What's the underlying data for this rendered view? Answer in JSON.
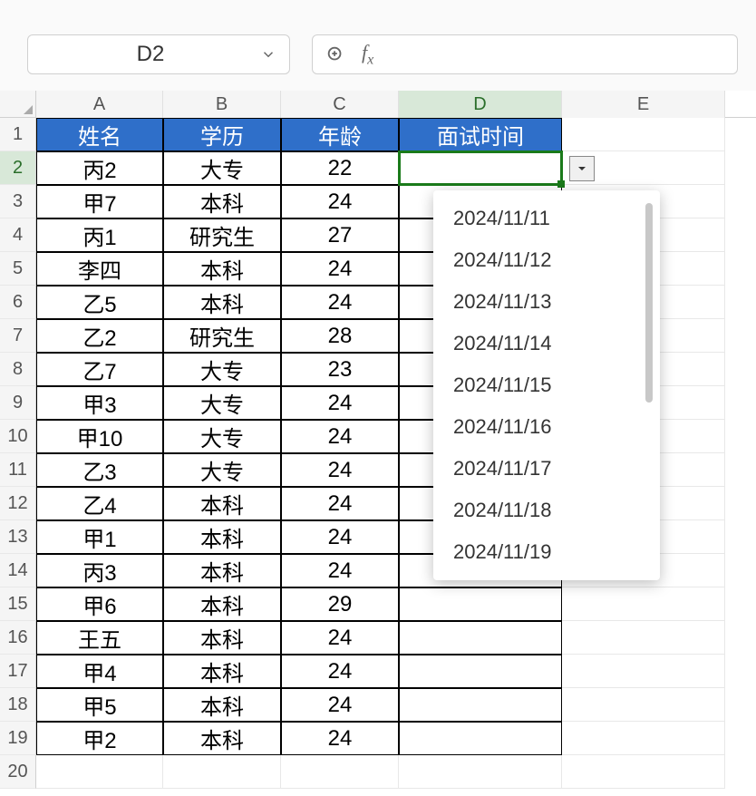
{
  "namebox": {
    "value": "D2"
  },
  "formula": {
    "value": ""
  },
  "columns": [
    "A",
    "B",
    "C",
    "D",
    "E"
  ],
  "col_widths": [
    "cA",
    "cB",
    "cC",
    "cD",
    "cE"
  ],
  "selected_col_index": 3,
  "row_numbers": [
    1,
    2,
    3,
    4,
    5,
    6,
    7,
    8,
    9,
    10,
    11,
    12,
    13,
    14,
    15,
    16,
    17,
    18,
    19,
    20
  ],
  "selected_row_index": 1,
  "headers": {
    "a": "姓名",
    "b": "学历",
    "c": "年龄",
    "d": "面试时间"
  },
  "data": [
    {
      "a": "丙2",
      "b": "大专",
      "c": "22",
      "d": ""
    },
    {
      "a": "甲7",
      "b": "本科",
      "c": "24",
      "d": ""
    },
    {
      "a": "丙1",
      "b": "研究生",
      "c": "27",
      "d": ""
    },
    {
      "a": "李四",
      "b": "本科",
      "c": "24",
      "d": ""
    },
    {
      "a": "乙5",
      "b": "本科",
      "c": "24",
      "d": ""
    },
    {
      "a": "乙2",
      "b": "研究生",
      "c": "28",
      "d": ""
    },
    {
      "a": "乙7",
      "b": "大专",
      "c": "23",
      "d": ""
    },
    {
      "a": "甲3",
      "b": "大专",
      "c": "24",
      "d": ""
    },
    {
      "a": "甲10",
      "b": "大专",
      "c": "24",
      "d": ""
    },
    {
      "a": "乙3",
      "b": "大专",
      "c": "24",
      "d": ""
    },
    {
      "a": "乙4",
      "b": "本科",
      "c": "24",
      "d": ""
    },
    {
      "a": "甲1",
      "b": "本科",
      "c": "24",
      "d": ""
    },
    {
      "a": "丙3",
      "b": "本科",
      "c": "24",
      "d": ""
    },
    {
      "a": "甲6",
      "b": "本科",
      "c": "29",
      "d": ""
    },
    {
      "a": "王五",
      "b": "本科",
      "c": "24",
      "d": ""
    },
    {
      "a": "甲4",
      "b": "本科",
      "c": "24",
      "d": ""
    },
    {
      "a": "甲5",
      "b": "本科",
      "c": "24",
      "d": ""
    },
    {
      "a": "甲2",
      "b": "本科",
      "c": "24",
      "d": ""
    }
  ],
  "dropdown": {
    "options": [
      "2024/11/11",
      "2024/11/12",
      "2024/11/13",
      "2024/11/14",
      "2024/11/15",
      "2024/11/16",
      "2024/11/17",
      "2024/11/18",
      "2024/11/19"
    ]
  },
  "chart_data": {
    "type": "table",
    "columns": [
      "姓名",
      "学历",
      "年龄",
      "面试时间"
    ],
    "rows": [
      [
        "丙2",
        "大专",
        22,
        ""
      ],
      [
        "甲7",
        "本科",
        24,
        ""
      ],
      [
        "丙1",
        "研究生",
        27,
        ""
      ],
      [
        "李四",
        "本科",
        24,
        ""
      ],
      [
        "乙5",
        "本科",
        24,
        ""
      ],
      [
        "乙2",
        "研究生",
        28,
        ""
      ],
      [
        "乙7",
        "大专",
        23,
        ""
      ],
      [
        "甲3",
        "大专",
        24,
        ""
      ],
      [
        "甲10",
        "大专",
        24,
        ""
      ],
      [
        "乙3",
        "大专",
        24,
        ""
      ],
      [
        "乙4",
        "本科",
        24,
        ""
      ],
      [
        "甲1",
        "本科",
        24,
        ""
      ],
      [
        "丙3",
        "本科",
        24,
        ""
      ],
      [
        "甲6",
        "本科",
        29,
        ""
      ],
      [
        "王五",
        "本科",
        24,
        ""
      ],
      [
        "甲4",
        "本科",
        24,
        ""
      ],
      [
        "甲5",
        "本科",
        24,
        ""
      ],
      [
        "甲2",
        "本科",
        24,
        ""
      ]
    ]
  }
}
